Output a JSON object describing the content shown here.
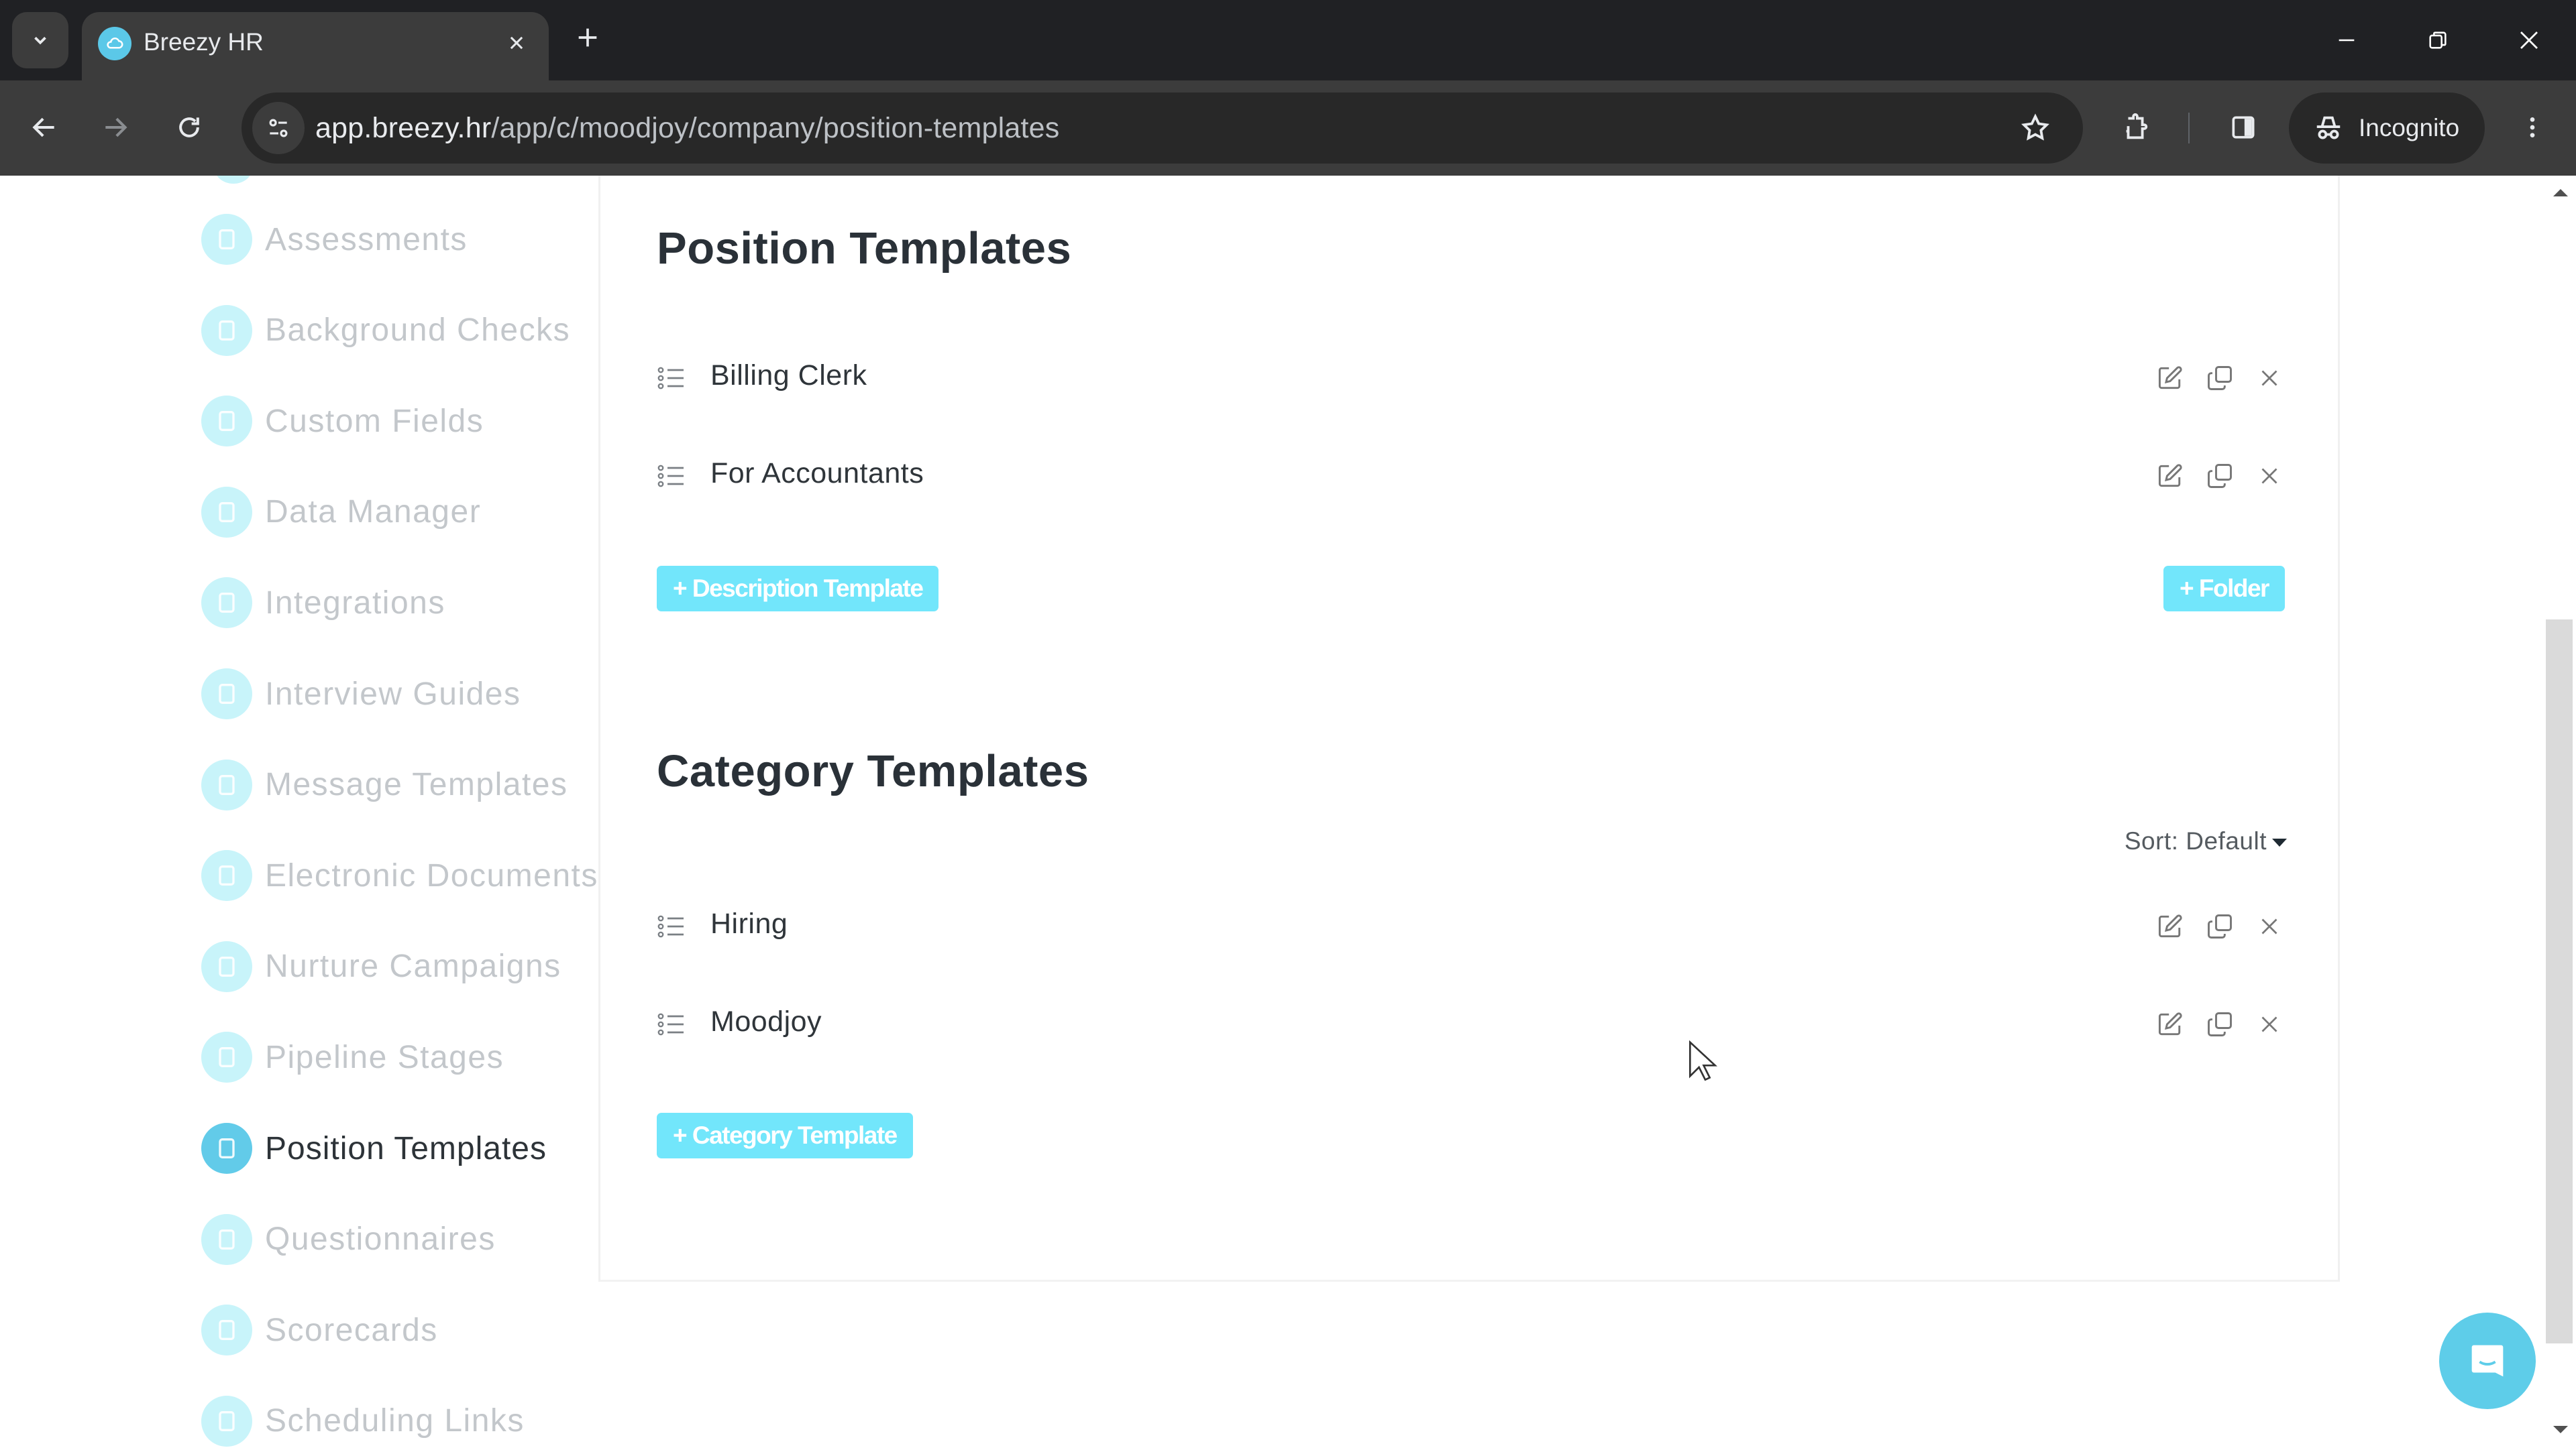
{
  "browser": {
    "tab_title": "Breezy HR",
    "url_host": "app.breezy.hr",
    "url_path": "/app/c/moodjoy/company/position-templates",
    "incognito_label": "Incognito"
  },
  "colors": {
    "accent": "#62cbe9",
    "button": "#72e6fb",
    "text_dark": "#2a3138",
    "text_muted": "#c3c7cb"
  },
  "sidebar": {
    "items": [
      {
        "label": "Assessments",
        "icon": "shield-icon"
      },
      {
        "label": "Background Checks",
        "icon": "id-card-icon"
      },
      {
        "label": "Custom Fields",
        "icon": "table-icon"
      },
      {
        "label": "Data Manager",
        "icon": "tag-icon"
      },
      {
        "label": "Integrations",
        "icon": "plug-icon"
      },
      {
        "label": "Interview Guides",
        "icon": "book-icon"
      },
      {
        "label": "Message Templates",
        "icon": "file-icon"
      },
      {
        "label": "Electronic Documents",
        "icon": "signature-icon"
      },
      {
        "label": "Nurture Campaigns",
        "icon": "refresh-icon"
      },
      {
        "label": "Pipeline Stages",
        "icon": "columns-icon"
      },
      {
        "label": "Position Templates",
        "icon": "document-icon",
        "active": true
      },
      {
        "label": "Questionnaires",
        "icon": "list-icon"
      },
      {
        "label": "Scorecards",
        "icon": "thumbs-up-icon"
      },
      {
        "label": "Scheduling Links",
        "icon": "calendar-icon"
      }
    ]
  },
  "position_templates": {
    "title": "Position Templates",
    "items": [
      {
        "label": "Billing Clerk"
      },
      {
        "label": "For Accountants"
      }
    ],
    "add_description_label": "+ Description Template",
    "add_folder_label": "+ Folder"
  },
  "category_templates": {
    "title": "Category Templates",
    "sort_label": "Sort: Default",
    "items": [
      {
        "label": "Hiring"
      },
      {
        "label": "Moodjoy"
      }
    ],
    "add_category_label": "+ Category Template"
  }
}
